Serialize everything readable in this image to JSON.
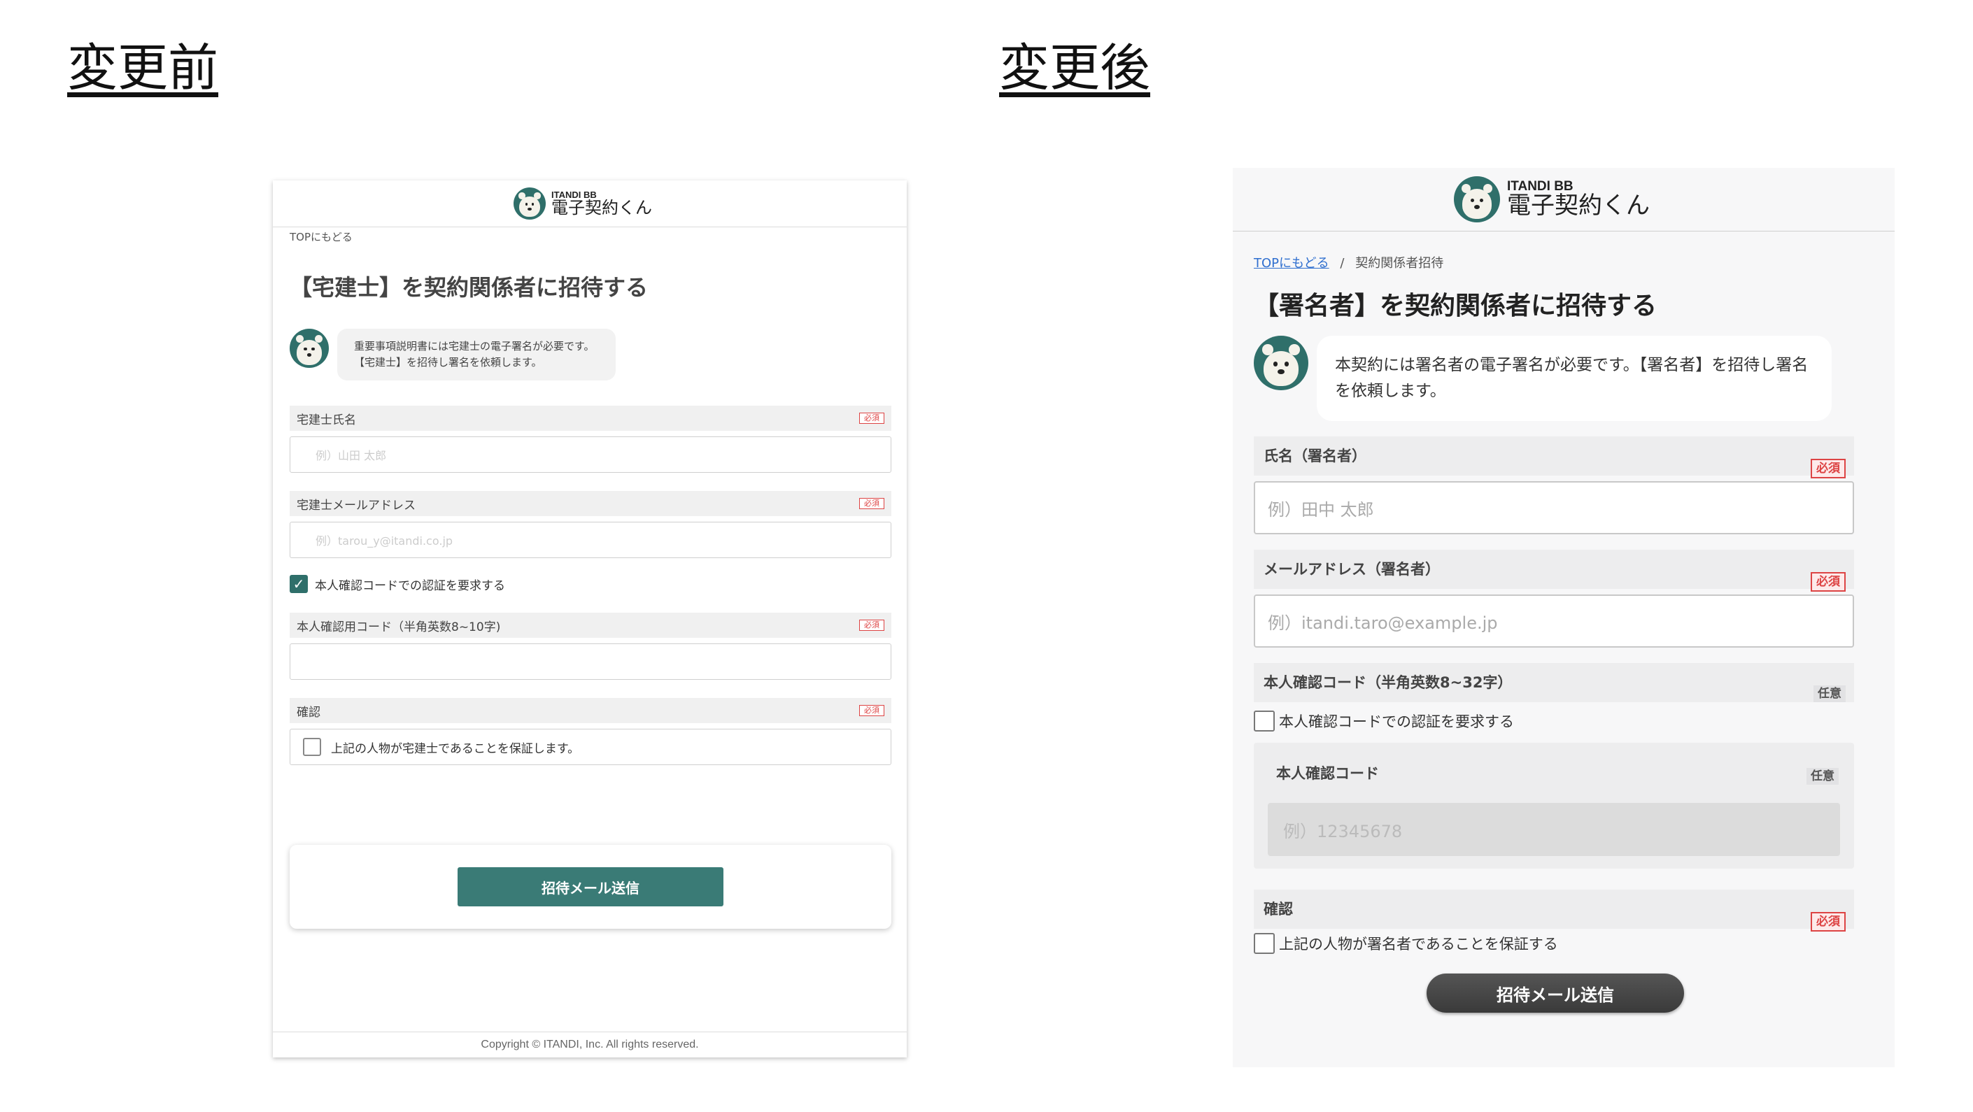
{
  "headings": {
    "before": "変更前",
    "after": "変更後"
  },
  "brand": {
    "sub": "ITANDI BB",
    "name": "電子契約くん"
  },
  "before": {
    "breadcrumb": "TOPにもどる",
    "title": "【宅建士】を契約関係者に招待する",
    "message_line1": "重要事項説明書には宅建士の電子署名が必要です。",
    "message_line2": "【宅建士】を招待し署名を依頼します。",
    "name_label": "宅建士氏名",
    "name_placeholder": "例）山田 太郎",
    "email_label": "宅建士メールアドレス",
    "email_placeholder": "例）tarou_y@itandi.co.jp",
    "require_code_label": "本人確認コードでの認証を要求する",
    "code_label": "本人確認用コード（半角英数8~10字)",
    "confirm_label": "確認",
    "confirm_text": "上記の人物が宅建士であることを保証します。",
    "required_badge": "必須",
    "submit_label": "招待メール送信",
    "footer": "Copyright © ITANDI, Inc. All rights reserved."
  },
  "after": {
    "breadcrumb_link": "TOPにもどる",
    "breadcrumb_sep": "/",
    "breadcrumb_current": "契約関係者招待",
    "title": "【署名者】を契約関係者に招待する",
    "message": "本契約には署名者の電子署名が必要です。【署名者】を招待し署名を依頼します。",
    "name_label": "氏名（署名者）",
    "name_placeholder": "例）田中 太郎",
    "email_label": "メールアドレス（署名者）",
    "email_placeholder": "例）itandi.taro@example.jp",
    "code_section_label": "本人確認コード（半角英数8~32字）",
    "require_code_label": "本人確認コードでの認証を要求する",
    "code_label": "本人確認コード",
    "code_placeholder": "例）12345678",
    "confirm_label": "確認",
    "confirm_text": "上記の人物が署名者であることを保証する",
    "required_badge": "必須",
    "optional_badge": "任意",
    "submit_label": "招待メール送信"
  },
  "colors": {
    "brand_green": "#2f6f6a",
    "required_red": "#d44444",
    "link_blue": "#2f6fcf",
    "after_button": "#444444"
  }
}
